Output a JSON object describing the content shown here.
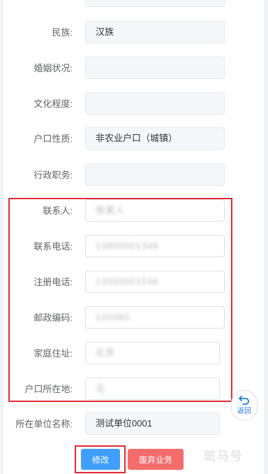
{
  "form": {
    "rows": [
      {
        "key": "ethnicity",
        "label": "民族:",
        "value": "汉族",
        "state": "disabled"
      },
      {
        "key": "marital",
        "label": "婚姻状况:",
        "value": "",
        "state": "disabled"
      },
      {
        "key": "education",
        "label": "文化程度:",
        "value": "",
        "state": "disabled"
      },
      {
        "key": "hukou_type",
        "label": "户口性质:",
        "value": "非农业户口（城镇）",
        "state": "disabled"
      },
      {
        "key": "admin_post",
        "label": "行政职务:",
        "value": "",
        "state": "disabled"
      },
      {
        "key": "contact",
        "label": "联系人:",
        "value": "张某人",
        "state": "editable-blurred"
      },
      {
        "key": "contact_phone",
        "label": "联系电话:",
        "value": "13800001348",
        "state": "editable-blurred"
      },
      {
        "key": "reg_phone",
        "label": "注册电话:",
        "value": "13500001546",
        "state": "editable-blurred"
      },
      {
        "key": "postcode",
        "label": "邮政编码:",
        "value": "100080",
        "state": "editable-blurred"
      },
      {
        "key": "home_address",
        "label": "家庭住址:",
        "value": "北京",
        "state": "editable-blurred"
      },
      {
        "key": "hukou_location",
        "label": "户口所在地:",
        "value": "北",
        "state": "editable-blurred"
      },
      {
        "key": "employer",
        "label": "所在单位名称:",
        "value": "测试单位0001",
        "state": "disabled"
      }
    ]
  },
  "back_button": {
    "icon": "undo-arrow-icon",
    "label": "返回"
  },
  "actions": {
    "modify_label": "修改",
    "abandon_label": "废弃业务"
  },
  "watermark": "斑马号",
  "colors": {
    "primary": "#409eff",
    "danger": "#f56c6c",
    "highlight": "#e02b35"
  }
}
